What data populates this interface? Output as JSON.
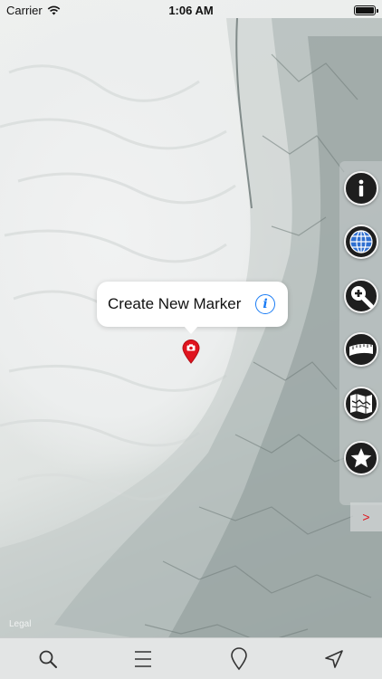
{
  "status_bar": {
    "carrier": "Carrier",
    "time": "1:06 AM",
    "wifi_icon": "wifi-icon",
    "battery_icon": "battery-icon"
  },
  "map": {
    "callout": {
      "title": "Create New Marker",
      "info_icon": "info-circle-icon"
    },
    "marker_icon": "map-pin-camera-icon",
    "attribution": "Legal"
  },
  "side_toolbar": {
    "buttons": [
      {
        "name": "info-button",
        "icon": "info-icon"
      },
      {
        "name": "globe-button",
        "icon": "globe-icon"
      },
      {
        "name": "zoom-button",
        "icon": "magnifier-plus-icon"
      },
      {
        "name": "ruler-button",
        "icon": "ruler-icon"
      },
      {
        "name": "map-layers-button",
        "icon": "folded-map-icon"
      },
      {
        "name": "favorites-button",
        "icon": "star-icon"
      }
    ],
    "expand_label": ">"
  },
  "tab_bar": {
    "items": [
      {
        "name": "search",
        "icon": "search-icon"
      },
      {
        "name": "menu",
        "icon": "menu-icon"
      },
      {
        "name": "marker",
        "icon": "map-marker-outline-icon"
      },
      {
        "name": "location",
        "icon": "navigation-arrow-icon"
      }
    ]
  },
  "colors": {
    "accent_blue": "#1a7cf5",
    "marker_red": "#e0141e",
    "toolbar_button_bg": "#1e1e1e",
    "tab_bar_bg": "#e3e5e5"
  }
}
